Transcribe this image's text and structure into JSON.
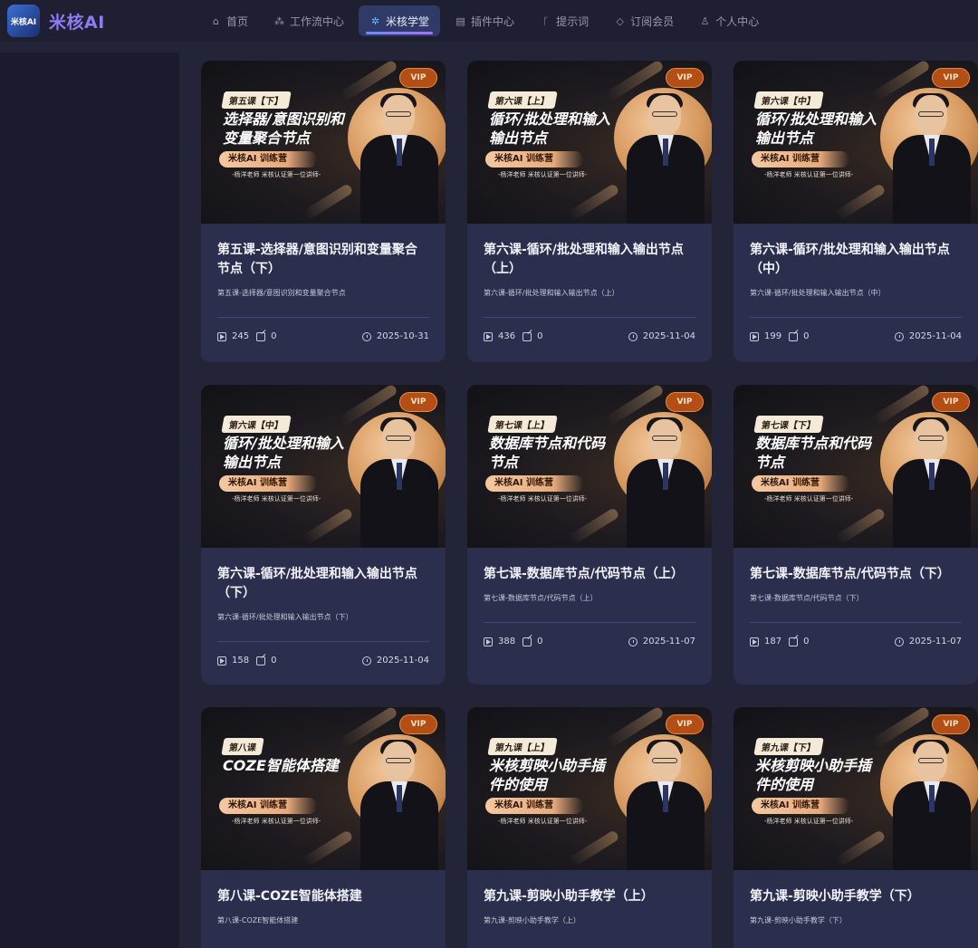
{
  "app": {
    "name": "米核AI",
    "logo_text": "米核AI"
  },
  "nav": [
    {
      "label": "首页",
      "icon": "home-icon",
      "glyph": "⌂"
    },
    {
      "label": "工作流中心",
      "icon": "workflow-icon",
      "glyph": "⁂"
    },
    {
      "label": "米核学堂",
      "icon": "academy-icon",
      "glyph": "✲",
      "active": true
    },
    {
      "label": "插件中心",
      "icon": "plugin-icon",
      "glyph": "▤"
    },
    {
      "label": "提示词",
      "icon": "prompt-icon",
      "glyph": "ᚴ"
    },
    {
      "label": "订阅会员",
      "icon": "diamond-icon",
      "glyph": "◇"
    },
    {
      "label": "个人中心",
      "icon": "user-icon",
      "glyph": "♙"
    }
  ],
  "cards": [
    {
      "tag": "第五课【下】",
      "cover_title": "选择器/意图识别和变量聚合节点",
      "camp": "米核AI 训练营",
      "teacher": "-杨洋老师 米核认证第一位讲师-",
      "vip": "VIP",
      "title": "第五课-选择器/意图识别和变量聚合节点（下）",
      "sub": "第五课-选择器/意图识别和变量聚合节点",
      "plays": "245",
      "notes": "0",
      "date": "2025-10-31"
    },
    {
      "tag": "第六课【上】",
      "cover_title": "循环/批处理和输入输出节点",
      "camp": "米核AI 训练营",
      "teacher": "-杨洋老师 米核认证第一位讲师-",
      "vip": "VIP",
      "title": "第六课-循环/批处理和输入输出节点（上）",
      "sub": "第六课-循环/批处理和输入输出节点（上）",
      "plays": "436",
      "notes": "0",
      "date": "2025-11-04"
    },
    {
      "tag": "第六课【中】",
      "cover_title": "循环/批处理和输入输出节点",
      "camp": "米核AI 训练营",
      "teacher": "-杨洋老师 米核认证第一位讲师-",
      "vip": "VIP",
      "title": "第六课-循环/批处理和输入输出节点（中）",
      "sub": "第六课-循环/批处理和输入输出节点（中）",
      "plays": "199",
      "notes": "0",
      "date": "2025-11-04"
    },
    {
      "tag": "第六课【中】",
      "cover_title": "循环/批处理和输入输出节点",
      "camp": "米核AI 训练营",
      "teacher": "-杨洋老师 米核认证第一位讲师-",
      "vip": "VIP",
      "title": "第六课-循环/批处理和输入输出节点（下）",
      "sub": "第六课-循环/批处理和输入输出节点（下）",
      "plays": "158",
      "notes": "0",
      "date": "2025-11-04"
    },
    {
      "tag": "第七课【上】",
      "cover_title": "数据库节点和代码节点",
      "camp": "米核AI 训练营",
      "teacher": "-杨洋老师 米核认证第一位讲师-",
      "vip": "VIP",
      "title": "第七课-数据库节点/代码节点（上）",
      "sub": "第七课-数据库节点/代码节点（上）",
      "plays": "388",
      "notes": "0",
      "date": "2025-11-07"
    },
    {
      "tag": "第七课【下】",
      "cover_title": "数据库节点和代码节点",
      "camp": "米核AI 训练营",
      "teacher": "-杨洋老师 米核认证第一位讲师-",
      "vip": "VIP",
      "title": "第七课-数据库节点/代码节点（下）",
      "sub": "第七课-数据库节点/代码节点（下）",
      "plays": "187",
      "notes": "0",
      "date": "2025-11-07"
    },
    {
      "tag": "第八课",
      "cover_title": "COZE智能体搭建",
      "camp": "米核AI 训练营",
      "teacher": "-杨洋老师 米核认证第一位讲师-",
      "vip": "VIP",
      "title": "第八课-COZE智能体搭建",
      "sub": "第八课-COZE智能体搭建",
      "plays": "",
      "notes": "",
      "date": ""
    },
    {
      "tag": "第九课【上】",
      "cover_title": "米核剪映小助手插件的使用",
      "camp": "米核AI 训练营",
      "teacher": "-杨洋老师 米核认证第一位讲师-",
      "vip": "VIP",
      "title": "第九课-剪映小助手教学（上）",
      "sub": "第九课-剪映小助手教学（上）",
      "plays": "",
      "notes": "",
      "date": ""
    },
    {
      "tag": "第九课【下】",
      "cover_title": "米核剪映小助手插件的使用",
      "camp": "米核AI 训练营",
      "teacher": "-杨洋老师 米核认证第一位讲师-",
      "vip": "VIP",
      "title": "第九课-剪映小助手教学（下）",
      "sub": "第九课-剪映小助手教学（下）",
      "plays": "",
      "notes": "",
      "date": ""
    }
  ]
}
